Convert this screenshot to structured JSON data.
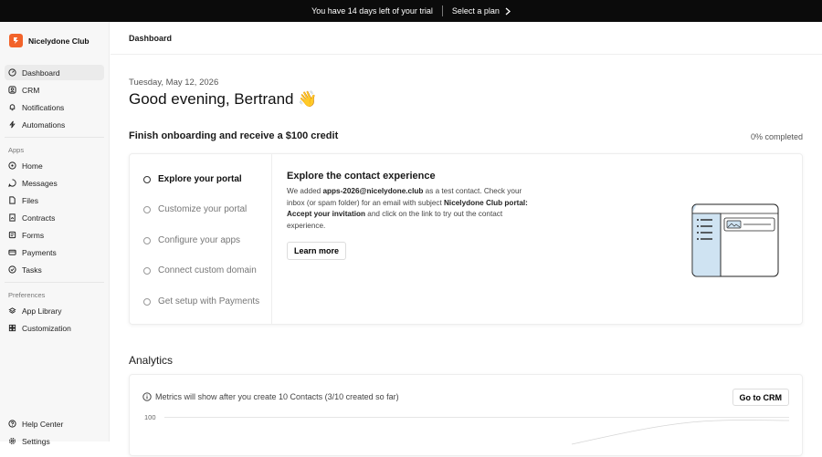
{
  "trial": {
    "message": "You have 14 days left of your trial",
    "cta": "Select a plan"
  },
  "brand": {
    "name": "Nicelydone Club",
    "color": "#f2632a"
  },
  "sidebar": {
    "main_items": [
      {
        "label": "Dashboard",
        "icon": "dashboard-icon",
        "active": true
      },
      {
        "label": "CRM",
        "icon": "user-icon"
      },
      {
        "label": "Notifications",
        "icon": "bell-icon"
      },
      {
        "label": "Automations",
        "icon": "lightning-icon"
      }
    ],
    "apps_heading": "Apps",
    "apps": [
      {
        "label": "Home",
        "icon": "home-icon"
      },
      {
        "label": "Messages",
        "icon": "message-icon"
      },
      {
        "label": "Files",
        "icon": "file-icon"
      },
      {
        "label": "Contracts",
        "icon": "contract-icon"
      },
      {
        "label": "Forms",
        "icon": "form-icon"
      },
      {
        "label": "Payments",
        "icon": "payment-icon"
      },
      {
        "label": "Tasks",
        "icon": "task-icon"
      }
    ],
    "preferences_heading": "Preferences",
    "preferences": [
      {
        "label": "App Library",
        "icon": "app-library-icon"
      },
      {
        "label": "Customization",
        "icon": "customization-icon"
      }
    ],
    "footer": [
      {
        "label": "Help Center",
        "icon": "help-icon"
      },
      {
        "label": "Settings",
        "icon": "gear-icon"
      }
    ]
  },
  "header": {
    "breadcrumb": "Dashboard"
  },
  "main": {
    "date": "Tuesday, May 12, 2026",
    "greeting": "Good evening, Bertrand 👋",
    "onboarding": {
      "title": "Finish onboarding and receive a $100 credit",
      "progress": "0% completed",
      "steps": [
        "Explore your portal",
        "Customize your portal",
        "Configure your apps",
        "Connect custom domain",
        "Get setup with Payments"
      ],
      "active_step": 0,
      "detail": {
        "title": "Explore the contact experience",
        "t1": "We added ",
        "email": "apps-2026@nicelydone.club",
        "t2": " as a test contact. Check your inbox (or spam folder) for an email with subject ",
        "subject": "Nicelydone Club portal: Accept your invitation",
        "t3": " and click on the link to try out the contact experience."
      },
      "learn_more": "Learn more"
    },
    "analytics": {
      "title": "Analytics",
      "note": "Metrics will show after you create 10 Contacts (3/10 created so far)",
      "cta": "Go to CRM",
      "y_tick": "100"
    }
  },
  "colors": {
    "illustration_fill": "#cfe3f2",
    "trial_bar": "#0b0b0b"
  }
}
